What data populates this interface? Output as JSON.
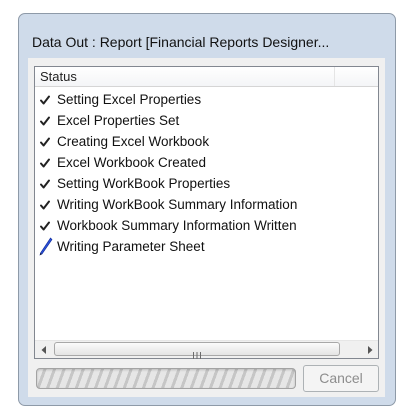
{
  "window": {
    "title": "Data Out : Report [Financial Reports Designer..."
  },
  "listview": {
    "column_header": "Status",
    "items": [
      {
        "label": "Setting Excel Properties",
        "icon": "check-icon"
      },
      {
        "label": "Excel Properties Set",
        "icon": "check-icon"
      },
      {
        "label": "Creating Excel Workbook",
        "icon": "check-icon"
      },
      {
        "label": "Excel Workbook Created",
        "icon": "check-icon"
      },
      {
        "label": "Setting WorkBook Properties",
        "icon": "check-icon"
      },
      {
        "label": "Writing WorkBook Summary Information",
        "icon": "check-icon"
      },
      {
        "label": "Workbook Summary Information Written",
        "icon": "check-icon"
      },
      {
        "label": "Writing Parameter Sheet",
        "icon": "pencil-icon"
      }
    ]
  },
  "scrollbar": {
    "left_icon": "arrow-left-icon",
    "right_icon": "arrow-right-icon",
    "grip_icon": "grip-icon"
  },
  "progress": {
    "state": "indeterminate"
  },
  "buttons": {
    "cancel_label": "Cancel"
  },
  "colors": {
    "frame": "#cfdbea",
    "client": "#f0f0f0",
    "pencil_accent": "#2a4fd6"
  }
}
